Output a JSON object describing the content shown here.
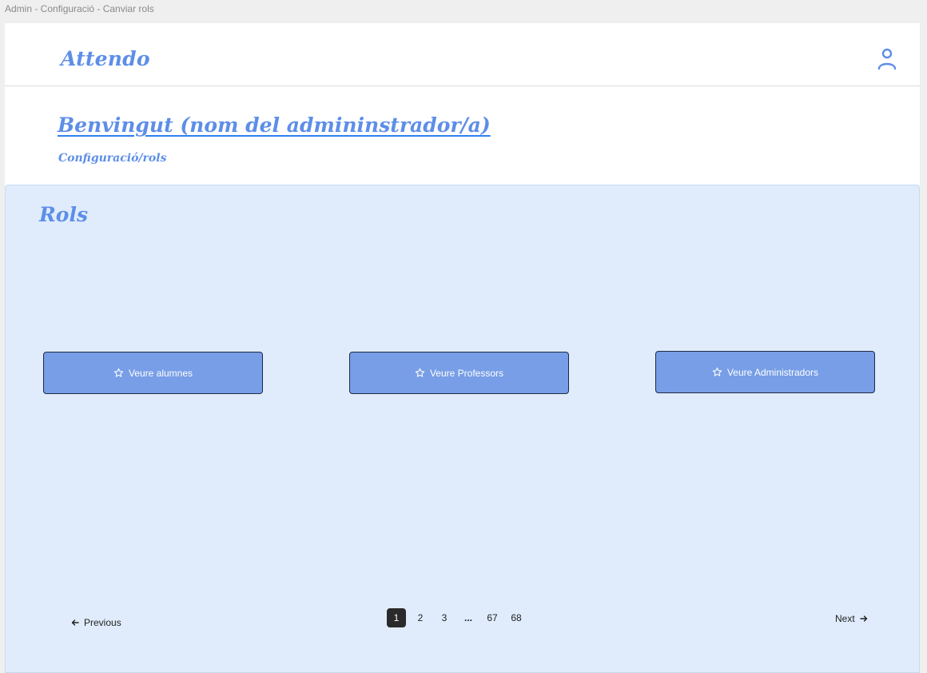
{
  "window": {
    "title": "Admin - Configuració - Canviar rols"
  },
  "header": {
    "brand": "Attendo",
    "user_icon": "user-icon"
  },
  "welcome": {
    "title": "Benvingut (nom del admininstrador/a)",
    "breadcrumb": "Configuració/rols"
  },
  "panel": {
    "title": "Rols",
    "buttons": [
      {
        "label": "Veure alumnes",
        "icon": "star-icon"
      },
      {
        "label": "Veure Professors",
        "icon": "star-icon"
      },
      {
        "label": "Veure Administradors",
        "icon": "star-icon"
      }
    ]
  },
  "pagination": {
    "previous": "Previous",
    "next": "Next",
    "pages": [
      "1",
      "2",
      "3",
      "...",
      "67",
      "68"
    ],
    "current": "1"
  },
  "colors": {
    "accent": "#5d8ee8",
    "button_bg": "#779ee6",
    "panel_bg": "#e0ecfc",
    "active_page": "#2a2a2a"
  }
}
